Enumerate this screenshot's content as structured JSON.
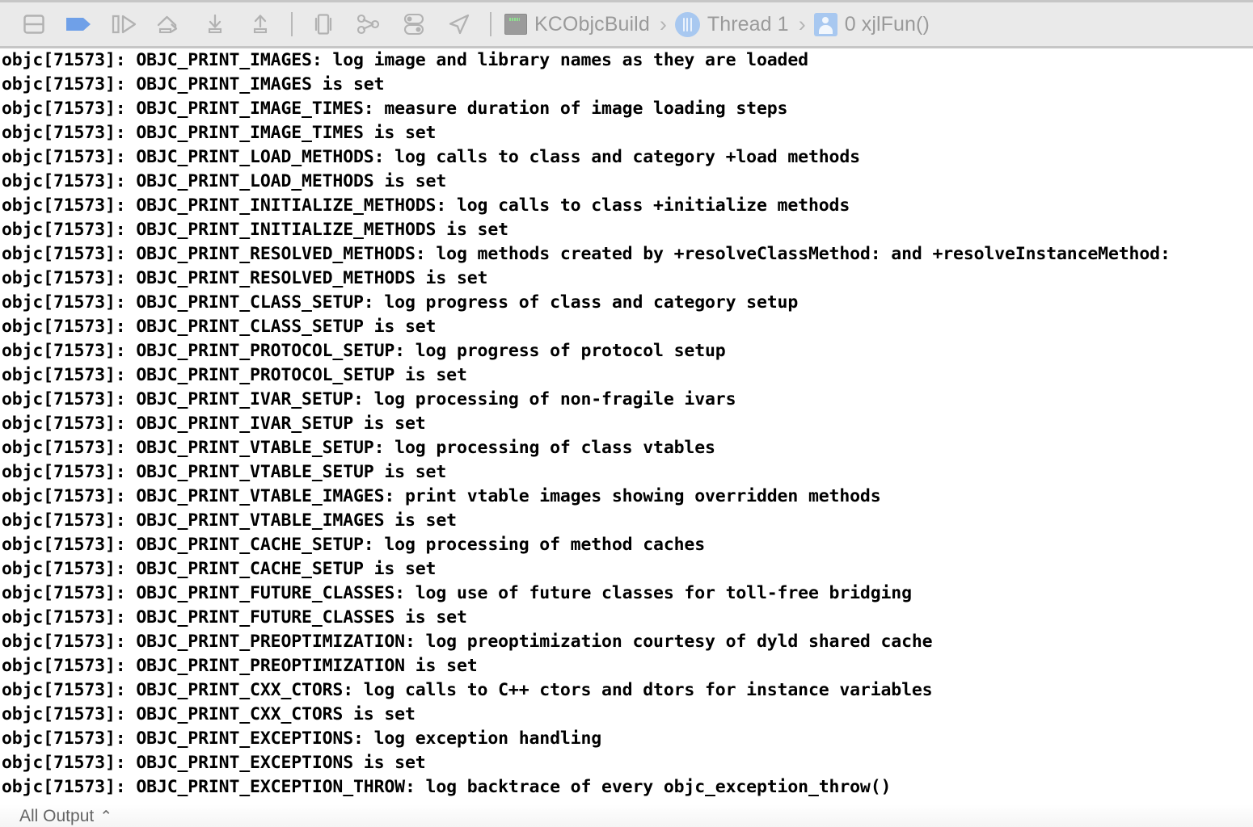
{
  "toolbar": {
    "buttons": [
      {
        "name": "toggle-console-panel",
        "icon": "panel-split-icon",
        "state": "inactive"
      },
      {
        "name": "toggle-breakpoints",
        "icon": "breakpoint-flag-icon",
        "state": "active",
        "color": "#6FA0E8"
      },
      {
        "name": "continue-program-execution",
        "icon": "continue-play-icon",
        "state": "inactive"
      },
      {
        "name": "step-over",
        "icon": "step-over-icon",
        "state": "inactive"
      },
      {
        "name": "step-into",
        "icon": "step-into-icon",
        "state": "inactive"
      },
      {
        "name": "step-out",
        "icon": "step-out-icon",
        "state": "inactive"
      }
    ],
    "buttons2": [
      {
        "name": "debug-view-hierarchy",
        "icon": "view-hierarchy-icon",
        "state": "inactive"
      },
      {
        "name": "debug-memory-graph",
        "icon": "memory-graph-icon",
        "state": "inactive"
      },
      {
        "name": "environment-overrides",
        "icon": "toggles-icon",
        "state": "inactive"
      }
    ],
    "buttons3": [
      {
        "name": "simulate-location",
        "icon": "location-arrow-icon",
        "state": "inactive"
      }
    ],
    "inactive_color": "#b2b2b2",
    "background": "#eaeaea",
    "border_color": "#c6c6c6"
  },
  "breadcrumb": {
    "separator": "›",
    "items": [
      {
        "icon": "app-process-icon",
        "label": "KCObjcBuild"
      },
      {
        "icon": "thread-icon",
        "label": "Thread 1"
      },
      {
        "icon": "stack-frame-icon",
        "label": "0 xjlFun()"
      }
    ]
  },
  "console": {
    "pid": "71573",
    "lines": [
      "objc[71573]: OBJC_PRINT_IMAGES: log image and library names as they are loaded",
      "objc[71573]: OBJC_PRINT_IMAGES is set",
      "objc[71573]: OBJC_PRINT_IMAGE_TIMES: measure duration of image loading steps",
      "objc[71573]: OBJC_PRINT_IMAGE_TIMES is set",
      "objc[71573]: OBJC_PRINT_LOAD_METHODS: log calls to class and category +load methods",
      "objc[71573]: OBJC_PRINT_LOAD_METHODS is set",
      "objc[71573]: OBJC_PRINT_INITIALIZE_METHODS: log calls to class +initialize methods",
      "objc[71573]: OBJC_PRINT_INITIALIZE_METHODS is set",
      "objc[71573]: OBJC_PRINT_RESOLVED_METHODS: log methods created by +resolveClassMethod: and +resolveInstanceMethod:",
      "objc[71573]: OBJC_PRINT_RESOLVED_METHODS is set",
      "objc[71573]: OBJC_PRINT_CLASS_SETUP: log progress of class and category setup",
      "objc[71573]: OBJC_PRINT_CLASS_SETUP is set",
      "objc[71573]: OBJC_PRINT_PROTOCOL_SETUP: log progress of protocol setup",
      "objc[71573]: OBJC_PRINT_PROTOCOL_SETUP is set",
      "objc[71573]: OBJC_PRINT_IVAR_SETUP: log processing of non-fragile ivars",
      "objc[71573]: OBJC_PRINT_IVAR_SETUP is set",
      "objc[71573]: OBJC_PRINT_VTABLE_SETUP: log processing of class vtables",
      "objc[71573]: OBJC_PRINT_VTABLE_SETUP is set",
      "objc[71573]: OBJC_PRINT_VTABLE_IMAGES: print vtable images showing overridden methods",
      "objc[71573]: OBJC_PRINT_VTABLE_IMAGES is set",
      "objc[71573]: OBJC_PRINT_CACHE_SETUP: log processing of method caches",
      "objc[71573]: OBJC_PRINT_CACHE_SETUP is set",
      "objc[71573]: OBJC_PRINT_FUTURE_CLASSES: log use of future classes for toll-free bridging",
      "objc[71573]: OBJC_PRINT_FUTURE_CLASSES is set",
      "objc[71573]: OBJC_PRINT_PREOPTIMIZATION: log preoptimization courtesy of dyld shared cache",
      "objc[71573]: OBJC_PRINT_PREOPTIMIZATION is set",
      "objc[71573]: OBJC_PRINT_CXX_CTORS: log calls to C++ ctors and dtors for instance variables",
      "objc[71573]: OBJC_PRINT_CXX_CTORS is set",
      "objc[71573]: OBJC_PRINT_EXCEPTIONS: log exception handling",
      "objc[71573]: OBJC_PRINT_EXCEPTIONS is set",
      "objc[71573]: OBJC_PRINT_EXCEPTION_THROW: log backtrace of every objc_exception_throw()"
    ],
    "text_color": "#000000",
    "background": "#ffffff"
  },
  "bottombar": {
    "filter_label": "All Output",
    "caret": "⌃"
  }
}
